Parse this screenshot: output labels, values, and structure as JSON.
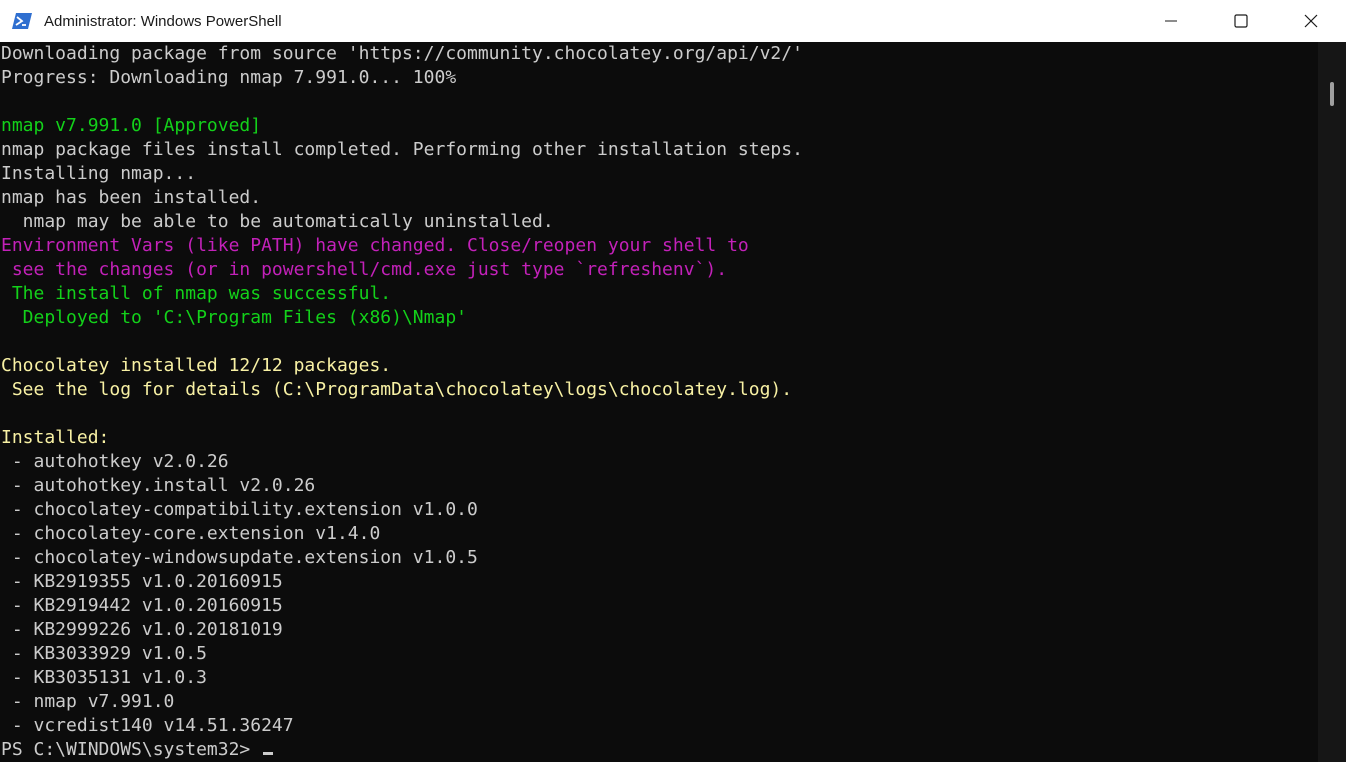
{
  "window": {
    "title": "Administrator: Windows PowerShell",
    "icon": "powershell-icon",
    "controls": [
      "minimize-icon",
      "maximize-icon",
      "close-icon"
    ]
  },
  "colors": {
    "default": "#cccccc",
    "green": "#13d11a",
    "magenta": "#c321b9",
    "yellow": "#f8f1a4",
    "background": "#0c0c0c"
  },
  "terminal": {
    "lines": [
      {
        "text": "Downloading package from source 'https://community.chocolatey.org/api/v2/'",
        "color": "default"
      },
      {
        "text": "Progress: Downloading nmap 7.991.0... 100%",
        "color": "default"
      },
      {
        "text": "",
        "color": "default"
      },
      {
        "text": "nmap v7.991.0 [Approved]",
        "color": "green"
      },
      {
        "text": "nmap package files install completed. Performing other installation steps.",
        "color": "default"
      },
      {
        "text": "Installing nmap...",
        "color": "default"
      },
      {
        "text": "nmap has been installed.",
        "color": "default"
      },
      {
        "text": "  nmap may be able to be automatically uninstalled.",
        "color": "default"
      },
      {
        "text": "Environment Vars (like PATH) have changed. Close/reopen your shell to",
        "color": "magenta"
      },
      {
        "text": " see the changes (or in powershell/cmd.exe just type `refreshenv`).",
        "color": "magenta"
      },
      {
        "text": " The install of nmap was successful.",
        "color": "green"
      },
      {
        "text": "  Deployed to 'C:\\Program Files (x86)\\Nmap'",
        "color": "green"
      },
      {
        "text": "",
        "color": "default"
      },
      {
        "text": "Chocolatey installed 12/12 packages.",
        "color": "yellow"
      },
      {
        "text": " See the log for details (C:\\ProgramData\\chocolatey\\logs\\chocolatey.log).",
        "color": "yellow"
      },
      {
        "text": "",
        "color": "default"
      },
      {
        "text": "Installed:",
        "color": "yellow"
      },
      {
        "text": " - autohotkey v2.0.26",
        "color": "default"
      },
      {
        "text": " - autohotkey.install v2.0.26",
        "color": "default"
      },
      {
        "text": " - chocolatey-compatibility.extension v1.0.0",
        "color": "default"
      },
      {
        "text": " - chocolatey-core.extension v1.4.0",
        "color": "default"
      },
      {
        "text": " - chocolatey-windowsupdate.extension v1.0.5",
        "color": "default"
      },
      {
        "text": " - KB2919355 v1.0.20160915",
        "color": "default"
      },
      {
        "text": " - KB2919442 v1.0.20160915",
        "color": "default"
      },
      {
        "text": " - KB2999226 v1.0.20181019",
        "color": "default"
      },
      {
        "text": " - KB3033929 v1.0.5",
        "color": "default"
      },
      {
        "text": " - KB3035131 v1.0.3",
        "color": "default"
      },
      {
        "text": " - nmap v7.991.0",
        "color": "default"
      },
      {
        "text": " - vcredist140 v14.51.36247",
        "color": "default"
      }
    ],
    "prompt": "PS C:\\WINDOWS\\system32>"
  }
}
